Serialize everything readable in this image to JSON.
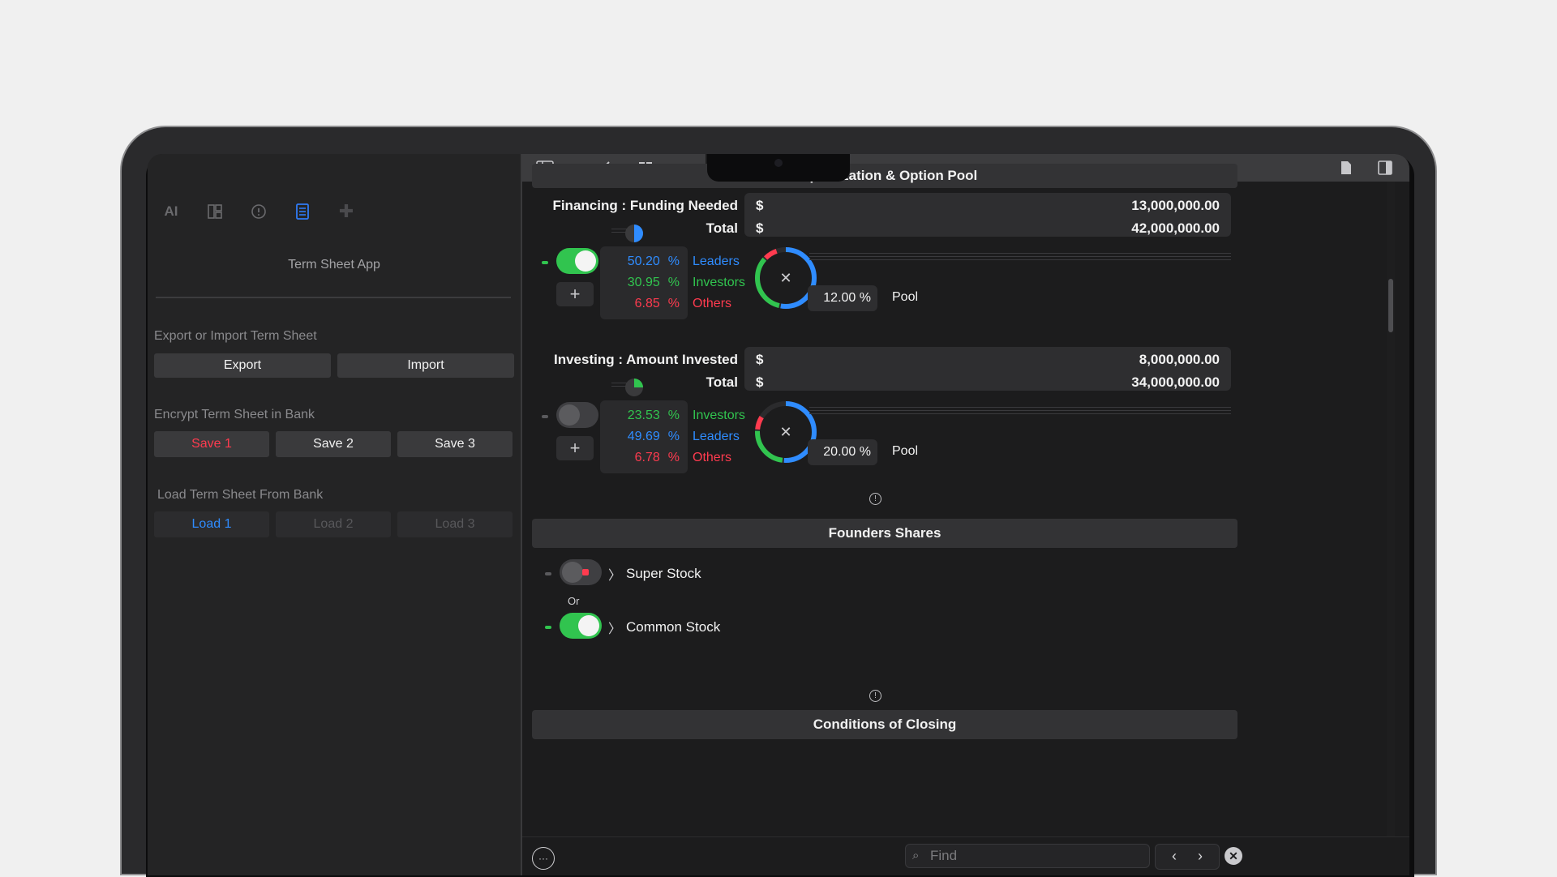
{
  "sidebar": {
    "icons": [
      "ai-icon",
      "layout-icon",
      "info-icon",
      "document-icon",
      "add-icon"
    ],
    "app_title": "Term Sheet App",
    "export_import": {
      "label": "Export or Import Term Sheet",
      "export": "Export",
      "import": "Import"
    },
    "encrypt": {
      "label": "Encrypt Term Sheet in Bank",
      "save1": "Save 1",
      "save2": "Save 2",
      "save3": "Save 3"
    },
    "load": {
      "label": "Load Term Sheet From Bank",
      "load1": "Load 1",
      "load2": "Load 2",
      "load3": "Load 3"
    }
  },
  "toolbar": {
    "icons": [
      "sidebar-toggle-icon",
      "back-icon",
      "grid-icon",
      "document-icon",
      "inspector-icon"
    ]
  },
  "capitalization": {
    "header": "Capitalization & Option Pool",
    "financing": {
      "label": "Financing : Funding Needed",
      "total_label": "Total",
      "currency": "$",
      "funding_needed": "13,000,000.00",
      "total": "42,000,000.00",
      "toggle_on": true,
      "rows": [
        {
          "pct": "50.20",
          "unit": "%",
          "name": "Leaders",
          "color": "#2f8cff"
        },
        {
          "pct": "30.95",
          "unit": "%",
          "name": "Investors",
          "color": "#31c44f"
        },
        {
          "pct": "6.85",
          "unit": "%",
          "name": "Others",
          "color": "#ff3b4f"
        }
      ],
      "pool_value": "12.00 %",
      "pool_label": "Pool"
    },
    "investing": {
      "label": "Investing : Amount Invested",
      "total_label": "Total",
      "currency": "$",
      "amount_invested": "8,000,000.00",
      "total": "34,000,000.00",
      "toggle_on": false,
      "rows": [
        {
          "pct": "23.53",
          "unit": "%",
          "name": "Investors",
          "color": "#31c44f"
        },
        {
          "pct": "49.69",
          "unit": "%",
          "name": "Leaders",
          "color": "#2f8cff"
        },
        {
          "pct": "6.78",
          "unit": "%",
          "name": "Others",
          "color": "#ff3b4f"
        }
      ],
      "pool_value": "20.00 %",
      "pool_label": "Pool"
    }
  },
  "founders": {
    "header": "Founders Shares",
    "super_stock": "Super Stock",
    "or": "Or",
    "common_stock": "Common Stock"
  },
  "closing": {
    "header": "Conditions of Closing"
  },
  "bottom": {
    "find_placeholder": "Find"
  }
}
